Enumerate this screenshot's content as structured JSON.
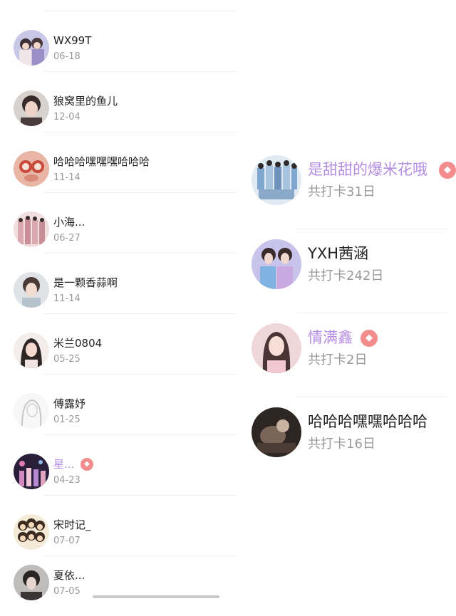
{
  "left_list": {
    "items": [
      {
        "name": "WX99T",
        "date": "06-18",
        "vip": false,
        "avatar": "avatar-photo-couple"
      },
      {
        "name": "狼窝里的鱼儿",
        "date": "12-04",
        "vip": false,
        "avatar": "avatar-photo-portrait"
      },
      {
        "name": "哈哈哈嘿嘿嘿哈哈哈",
        "date": "11-14",
        "vip": false,
        "avatar": "avatar-photo-pink-glasses"
      },
      {
        "name": "小海...",
        "date": "06-27",
        "vip": false,
        "avatar": "avatar-photo-group"
      },
      {
        "name": "是一颗香蒜啊",
        "date": "11-14",
        "vip": false,
        "avatar": "avatar-photo-boy"
      },
      {
        "name": "米兰0804",
        "date": "05-25",
        "vip": false,
        "avatar": "avatar-photo-girl"
      },
      {
        "name": "傅露妤",
        "date": "01-25",
        "vip": false,
        "avatar": "avatar-photo-sketch"
      },
      {
        "name": "星...",
        "date": "04-23",
        "vip": true,
        "avatar": "avatar-photo-stage"
      },
      {
        "name": "宋时记_",
        "date": "07-07",
        "vip": false,
        "avatar": "avatar-cartoon-group"
      },
      {
        "name": "夏依...",
        "date": "07-05",
        "vip": false,
        "avatar": "avatar-photo-dark"
      }
    ]
  },
  "right_list": {
    "items": [
      {
        "name": "是甜甜的爆米花哦",
        "subtitle": "共打卡31日",
        "vip": true,
        "avatar": "avatar-photo-group-blue"
      },
      {
        "name": "YXH茜涵",
        "subtitle": "共打卡242日",
        "vip": false,
        "avatar": "avatar-photo-duo"
      },
      {
        "name": "情满鑫",
        "subtitle": "共打卡2日",
        "vip": true,
        "avatar": "avatar-photo-girl-pink"
      },
      {
        "name": "哈哈哈嘿嘿哈哈哈",
        "subtitle": "共打卡16日",
        "vip": false,
        "avatar": "avatar-photo-dark-scene"
      }
    ]
  },
  "vip_badge_icon": "diamond-icon",
  "colors": {
    "vip_name": "#b48de2",
    "vip_badge": "#f38c8c",
    "date": "#999999"
  }
}
